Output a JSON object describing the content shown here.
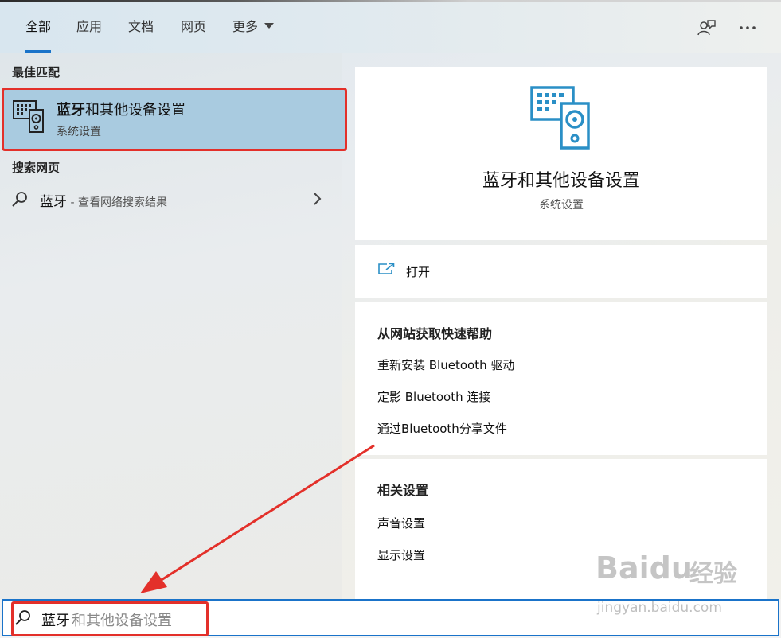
{
  "tabs": [
    {
      "label": "全部"
    },
    {
      "label": "应用"
    },
    {
      "label": "文档"
    },
    {
      "label": "网页"
    },
    {
      "label": "更多"
    }
  ],
  "toolbar": {
    "feedback_icon": "feedback-icon",
    "more_icon": "ellipsis-icon"
  },
  "left": {
    "best_match_label": "最佳匹配",
    "best_match": {
      "title_bold": "蓝牙",
      "title_rest": "和其他设备设置",
      "subtitle": "系统设置"
    },
    "web_label": "搜索网页",
    "web_result": {
      "query": "蓝牙",
      "hint": " - 查看网络搜索结果"
    }
  },
  "right": {
    "name": "蓝牙和其他设备设置",
    "subtitle": "系统设置",
    "open_label": "打开",
    "help": {
      "heading": "从网站获取快速帮助",
      "links": [
        "重新安装 Bluetooth 驱动",
        "定影 Bluetooth 连接",
        "通过Bluetooth分享文件"
      ]
    },
    "related": {
      "heading": "相关设置",
      "links": [
        "声音设置",
        "显示设置"
      ]
    }
  },
  "search": {
    "typed": "蓝牙",
    "suggestion": "和其他设备设置"
  },
  "watermark": {
    "logo": "Baidu",
    "logo_cn": "经验",
    "url": "jingyan.baidu.com"
  },
  "colors": {
    "accent": "#1a73c9",
    "highlight": "#a9cbe0",
    "annotation": "#e3302a",
    "icon_blue": "#2a8fc6"
  }
}
